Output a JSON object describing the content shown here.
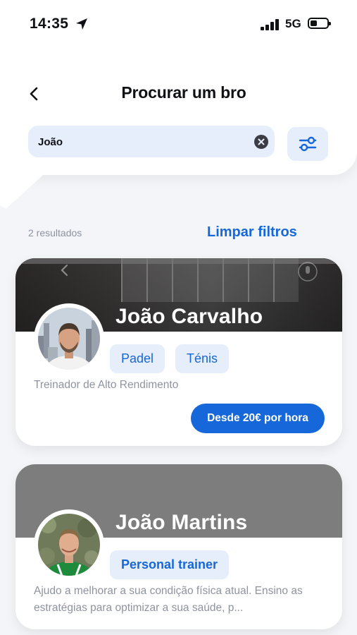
{
  "status_bar": {
    "time": "14:35",
    "network": "5G",
    "location_icon": "location-arrow-icon",
    "signal_icon": "signal-bars-icon",
    "battery_icon": "battery-icon",
    "battery_level": 0.4
  },
  "header": {
    "title": "Procurar um bro",
    "back_icon": "chevron-left-icon"
  },
  "search": {
    "value": "João",
    "clear_icon": "clear-x-icon",
    "filter_icon": "sliders-icon"
  },
  "results": {
    "count_label": "2 resultados",
    "clear_filters_label": "Limpar filtros"
  },
  "cards": [
    {
      "name": "João Carvalho",
      "tags": [
        "Padel",
        "Ténis"
      ],
      "subtitle": "Treinador de Alto Rendimento",
      "price_label": "Desde 20€ por hora"
    },
    {
      "name": "João Martins",
      "tags": [
        "Personal trainer"
      ],
      "description": "Ajudo a melhorar a sua condição física atual. Ensino as estratégias para optimizar a sua saúde, p..."
    }
  ],
  "colors": {
    "accent": "#1667d9",
    "tag_bg": "#e6eefc",
    "muted_text": "#8e93a0",
    "page_bg": "#f4f5f8"
  }
}
